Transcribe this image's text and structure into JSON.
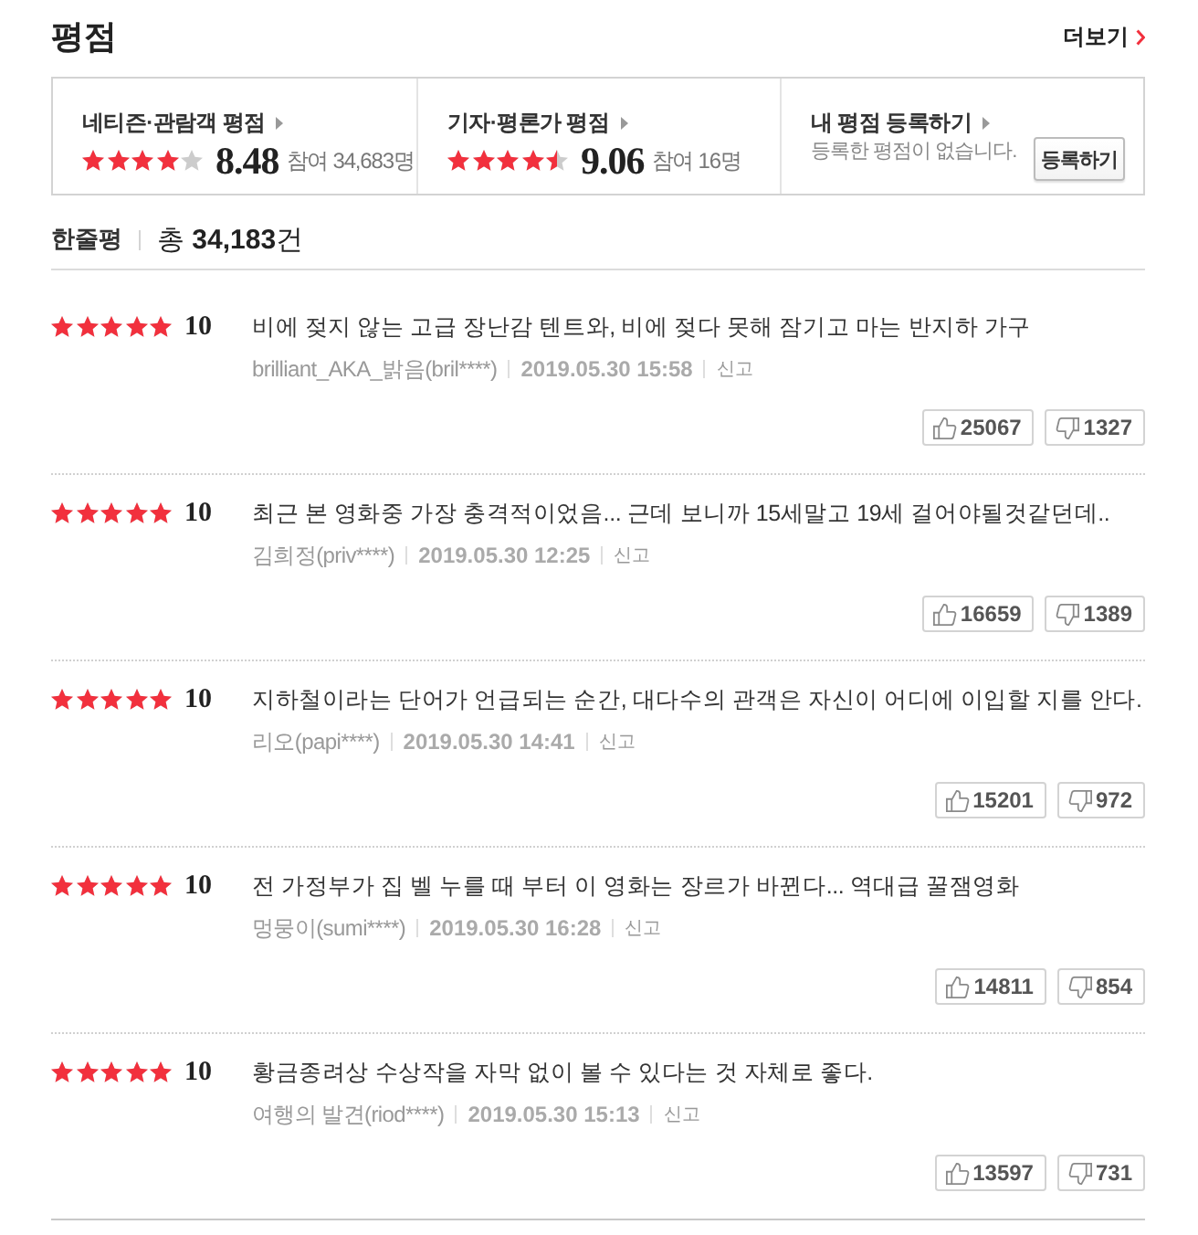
{
  "header": {
    "title": "평점",
    "more_link": "더보기"
  },
  "rating_summary": [
    {
      "kind": "score",
      "label": "네티즌·관람객 평점",
      "stars": 4,
      "score": "8.48",
      "participants": "참여 34,683명"
    },
    {
      "kind": "score",
      "label": "기자·평론가 평점",
      "stars": 4.5,
      "score": "9.06",
      "participants": "참여 16명"
    },
    {
      "kind": "register",
      "label": "내 평점 등록하기",
      "message": "등록한 평점이 없습니다.",
      "button": "등록하기"
    }
  ],
  "review_count": {
    "label": "한줄평",
    "total": "총 **34,183**건"
  },
  "comments": [
    {
      "stars": 5,
      "score": "10",
      "text": "비에 젖지 않는 고급 장난감 텐트와, 비에 젖다 못해 잠기고 마는 반지하 가구",
      "author": "brilliant_AKA_밝음(bril****)",
      "date": "2019.05.30 15:58",
      "report": "신고",
      "likes": "25067",
      "dislikes": "1327"
    },
    {
      "stars": 5,
      "score": "10",
      "text": "최근 본 영화중 가장 충격적이었음... 근데 보니까 15세말고 19세 걸어야될것같던데..",
      "author": "김희정(priv****)",
      "date": "2019.05.30 12:25",
      "report": "신고",
      "likes": "16659",
      "dislikes": "1389"
    },
    {
      "stars": 5,
      "score": "10",
      "text": "지하철이라는 단어가 언급되는 순간, 대다수의 관객은 자신이 어디에 이입할 지를 안다.",
      "author": "리오(papi****)",
      "date": "2019.05.30 14:41",
      "report": "신고",
      "likes": "15201",
      "dislikes": "972"
    },
    {
      "stars": 5,
      "score": "10",
      "text": "전 가정부가 집 벨 누를 때 부터 이 영화는 장르가 바뀐다... 역대급 꿀잼영화",
      "author": "멍뭉이(sumi****)",
      "date": "2019.05.30 16:28",
      "report": "신고",
      "likes": "14811",
      "dislikes": "854"
    },
    {
      "stars": 5,
      "score": "10",
      "text": "황금종려상 수상작을 자막 없이 볼 수 있다는 것 자체로 좋다.",
      "author": "여행의 발견(riod****)",
      "date": "2019.05.30 15:13",
      "report": "신고",
      "likes": "13597",
      "dislikes": "731"
    }
  ]
}
